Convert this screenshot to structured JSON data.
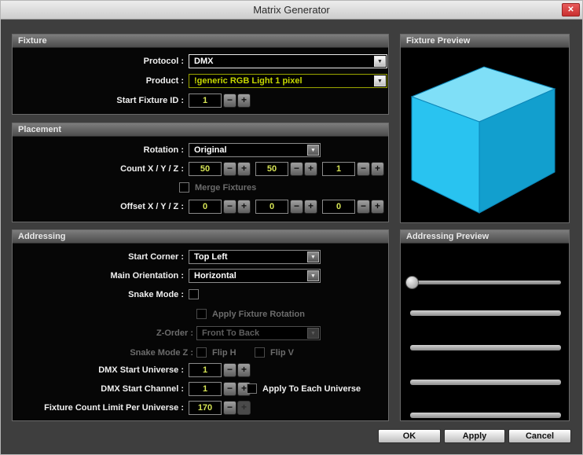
{
  "window": {
    "title": "Matrix Generator"
  },
  "ui": {
    "minus": "−",
    "plus": "+",
    "dropdown_arrow": "▼",
    "close": "✕"
  },
  "colors": {
    "value_text": "#d6e455",
    "product_text": "#c6d800",
    "close_red": "#c93030",
    "cube_top": "#7fdff7",
    "cube_front": "#29c3f0",
    "cube_right": "#129fce"
  },
  "fixture": {
    "title": "Fixture",
    "protocol_label": "Protocol :",
    "protocol_value": "DMX",
    "product_label": "Product :",
    "product_value": "!generic RGB Light 1 pixel",
    "start_fixture_id_label": "Start Fixture ID :",
    "start_fixture_id_value": "1"
  },
  "placement": {
    "title": "Placement",
    "rotation_label": "Rotation :",
    "rotation_value": "Original",
    "count_label": "Count X / Y / Z :",
    "count_x": "50",
    "count_y": "50",
    "count_z": "1",
    "merge_fixtures_label": "Merge Fixtures",
    "offset_label": "Offset X / Y / Z :",
    "offset_x": "0",
    "offset_y": "0",
    "offset_z": "0"
  },
  "addressing": {
    "title": "Addressing",
    "start_corner_label": "Start Corner :",
    "start_corner_value": "Top Left",
    "main_orientation_label": "Main Orientation :",
    "main_orientation_value": "Horizontal",
    "snake_mode_label": "Snake Mode :",
    "apply_fixture_rotation_label": "Apply Fixture Rotation",
    "z_order_label": "Z-Order :",
    "z_order_value": "Front To Back",
    "snake_mode_z_label": "Snake Mode Z :",
    "flip_h_label": "Flip H",
    "flip_v_label": "Flip V",
    "dmx_start_universe_label": "DMX Start Universe :",
    "dmx_start_universe_value": "1",
    "dmx_start_channel_label": "DMX Start Channel :",
    "dmx_start_channel_value": "1",
    "apply_to_each_universe_label": "Apply To Each Universe",
    "fixture_count_limit_label": "Fixture Count Limit Per Universe :",
    "fixture_count_limit_value": "170"
  },
  "previews": {
    "fixture_title": "Fixture Preview",
    "addressing_title": "Addressing Preview"
  },
  "buttons": {
    "ok": "OK",
    "apply": "Apply",
    "cancel": "Cancel"
  }
}
